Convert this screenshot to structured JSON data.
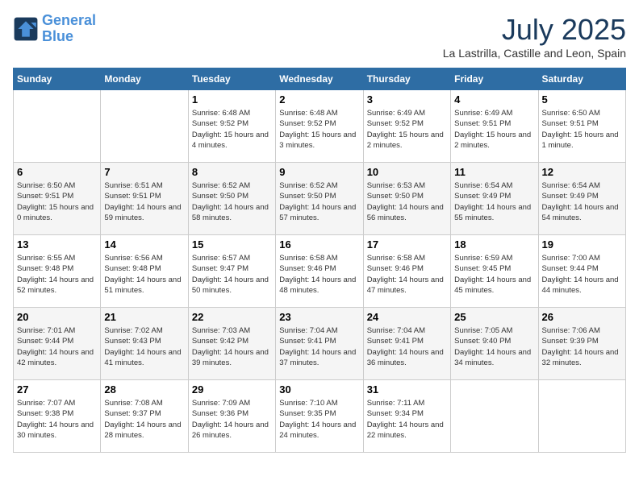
{
  "logo": {
    "line1": "General",
    "line2": "Blue"
  },
  "title": "July 2025",
  "subtitle": "La Lastrilla, Castille and Leon, Spain",
  "headers": [
    "Sunday",
    "Monday",
    "Tuesday",
    "Wednesday",
    "Thursday",
    "Friday",
    "Saturday"
  ],
  "weeks": [
    [
      {
        "day": "",
        "info": ""
      },
      {
        "day": "",
        "info": ""
      },
      {
        "day": "1",
        "info": "Sunrise: 6:48 AM\nSunset: 9:52 PM\nDaylight: 15 hours and 4 minutes."
      },
      {
        "day": "2",
        "info": "Sunrise: 6:48 AM\nSunset: 9:52 PM\nDaylight: 15 hours and 3 minutes."
      },
      {
        "day": "3",
        "info": "Sunrise: 6:49 AM\nSunset: 9:52 PM\nDaylight: 15 hours and 2 minutes."
      },
      {
        "day": "4",
        "info": "Sunrise: 6:49 AM\nSunset: 9:51 PM\nDaylight: 15 hours and 2 minutes."
      },
      {
        "day": "5",
        "info": "Sunrise: 6:50 AM\nSunset: 9:51 PM\nDaylight: 15 hours and 1 minute."
      }
    ],
    [
      {
        "day": "6",
        "info": "Sunrise: 6:50 AM\nSunset: 9:51 PM\nDaylight: 15 hours and 0 minutes."
      },
      {
        "day": "7",
        "info": "Sunrise: 6:51 AM\nSunset: 9:51 PM\nDaylight: 14 hours and 59 minutes."
      },
      {
        "day": "8",
        "info": "Sunrise: 6:52 AM\nSunset: 9:50 PM\nDaylight: 14 hours and 58 minutes."
      },
      {
        "day": "9",
        "info": "Sunrise: 6:52 AM\nSunset: 9:50 PM\nDaylight: 14 hours and 57 minutes."
      },
      {
        "day": "10",
        "info": "Sunrise: 6:53 AM\nSunset: 9:50 PM\nDaylight: 14 hours and 56 minutes."
      },
      {
        "day": "11",
        "info": "Sunrise: 6:54 AM\nSunset: 9:49 PM\nDaylight: 14 hours and 55 minutes."
      },
      {
        "day": "12",
        "info": "Sunrise: 6:54 AM\nSunset: 9:49 PM\nDaylight: 14 hours and 54 minutes."
      }
    ],
    [
      {
        "day": "13",
        "info": "Sunrise: 6:55 AM\nSunset: 9:48 PM\nDaylight: 14 hours and 52 minutes."
      },
      {
        "day": "14",
        "info": "Sunrise: 6:56 AM\nSunset: 9:48 PM\nDaylight: 14 hours and 51 minutes."
      },
      {
        "day": "15",
        "info": "Sunrise: 6:57 AM\nSunset: 9:47 PM\nDaylight: 14 hours and 50 minutes."
      },
      {
        "day": "16",
        "info": "Sunrise: 6:58 AM\nSunset: 9:46 PM\nDaylight: 14 hours and 48 minutes."
      },
      {
        "day": "17",
        "info": "Sunrise: 6:58 AM\nSunset: 9:46 PM\nDaylight: 14 hours and 47 minutes."
      },
      {
        "day": "18",
        "info": "Sunrise: 6:59 AM\nSunset: 9:45 PM\nDaylight: 14 hours and 45 minutes."
      },
      {
        "day": "19",
        "info": "Sunrise: 7:00 AM\nSunset: 9:44 PM\nDaylight: 14 hours and 44 minutes."
      }
    ],
    [
      {
        "day": "20",
        "info": "Sunrise: 7:01 AM\nSunset: 9:44 PM\nDaylight: 14 hours and 42 minutes."
      },
      {
        "day": "21",
        "info": "Sunrise: 7:02 AM\nSunset: 9:43 PM\nDaylight: 14 hours and 41 minutes."
      },
      {
        "day": "22",
        "info": "Sunrise: 7:03 AM\nSunset: 9:42 PM\nDaylight: 14 hours and 39 minutes."
      },
      {
        "day": "23",
        "info": "Sunrise: 7:04 AM\nSunset: 9:41 PM\nDaylight: 14 hours and 37 minutes."
      },
      {
        "day": "24",
        "info": "Sunrise: 7:04 AM\nSunset: 9:41 PM\nDaylight: 14 hours and 36 minutes."
      },
      {
        "day": "25",
        "info": "Sunrise: 7:05 AM\nSunset: 9:40 PM\nDaylight: 14 hours and 34 minutes."
      },
      {
        "day": "26",
        "info": "Sunrise: 7:06 AM\nSunset: 9:39 PM\nDaylight: 14 hours and 32 minutes."
      }
    ],
    [
      {
        "day": "27",
        "info": "Sunrise: 7:07 AM\nSunset: 9:38 PM\nDaylight: 14 hours and 30 minutes."
      },
      {
        "day": "28",
        "info": "Sunrise: 7:08 AM\nSunset: 9:37 PM\nDaylight: 14 hours and 28 minutes."
      },
      {
        "day": "29",
        "info": "Sunrise: 7:09 AM\nSunset: 9:36 PM\nDaylight: 14 hours and 26 minutes."
      },
      {
        "day": "30",
        "info": "Sunrise: 7:10 AM\nSunset: 9:35 PM\nDaylight: 14 hours and 24 minutes."
      },
      {
        "day": "31",
        "info": "Sunrise: 7:11 AM\nSunset: 9:34 PM\nDaylight: 14 hours and 22 minutes."
      },
      {
        "day": "",
        "info": ""
      },
      {
        "day": "",
        "info": ""
      }
    ]
  ]
}
